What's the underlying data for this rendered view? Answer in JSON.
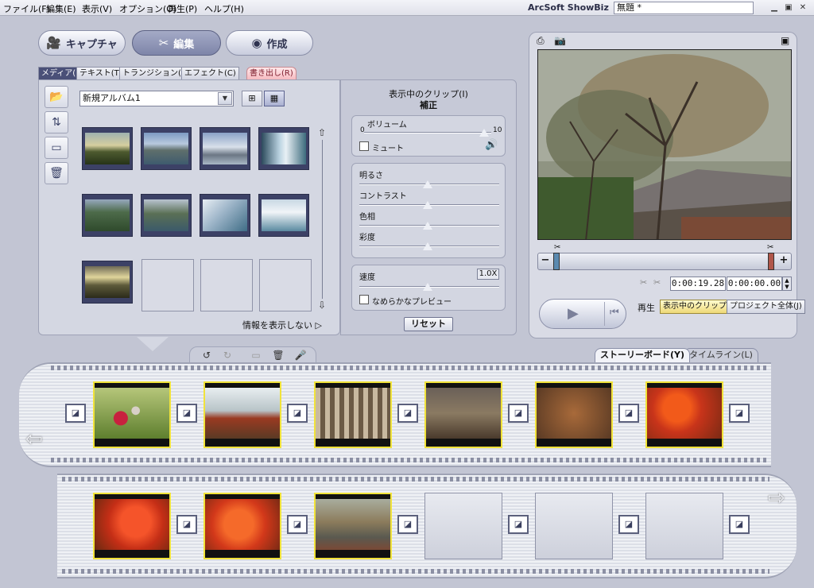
{
  "menubar": {
    "items": [
      "ファイル(F)",
      "編集(E)",
      "表示(V)",
      "オプション(O)",
      "再生(P)",
      "ヘルプ(H)"
    ],
    "app_title": "ArcSoft ShowBiz",
    "project_name": "無題 *"
  },
  "main_tabs": [
    {
      "label": "キャプチャ",
      "icon": "video-camera-icon"
    },
    {
      "label": "編集",
      "icon": "scissors-icon"
    },
    {
      "label": "作成",
      "icon": "disc-icon"
    }
  ],
  "sub_tabs": [
    "メディア(M)",
    "テキスト(T)",
    "トランジション(N)",
    "エフェクト(C)"
  ],
  "export_tab": "書き出し(R)",
  "media": {
    "album": "新規アルバム1",
    "info_link": "情報を表示しない"
  },
  "adjust": {
    "header": "表示中のクリップ(I)",
    "subheader": "補正",
    "volume_label": "ボリューム",
    "volume_min": "0",
    "volume_max": "10",
    "mute_label": "ミュート",
    "brightness": "明るさ",
    "contrast": "コントラスト",
    "hue": "色相",
    "saturation": "彩度",
    "speed_label": "速度",
    "speed_value": "1.0X",
    "smooth_preview": "なめらかなプレビュー",
    "reset_button": "リセット"
  },
  "preview": {
    "time_current": "0:00:19.28",
    "time_total": "0:00:00.00",
    "play_label": "再生",
    "mode_clip": "表示中のクリップ(A)",
    "mode_project": "プロジェクト全体(J)"
  },
  "storyboard": {
    "tab_storyboard": "ストーリーボード(Y)",
    "tab_timeline": "タイムライン(L)"
  },
  "colors": {
    "accent": "#4a5078",
    "clip_border": "#f1e33a",
    "export_tab": "#f5b7bd"
  }
}
